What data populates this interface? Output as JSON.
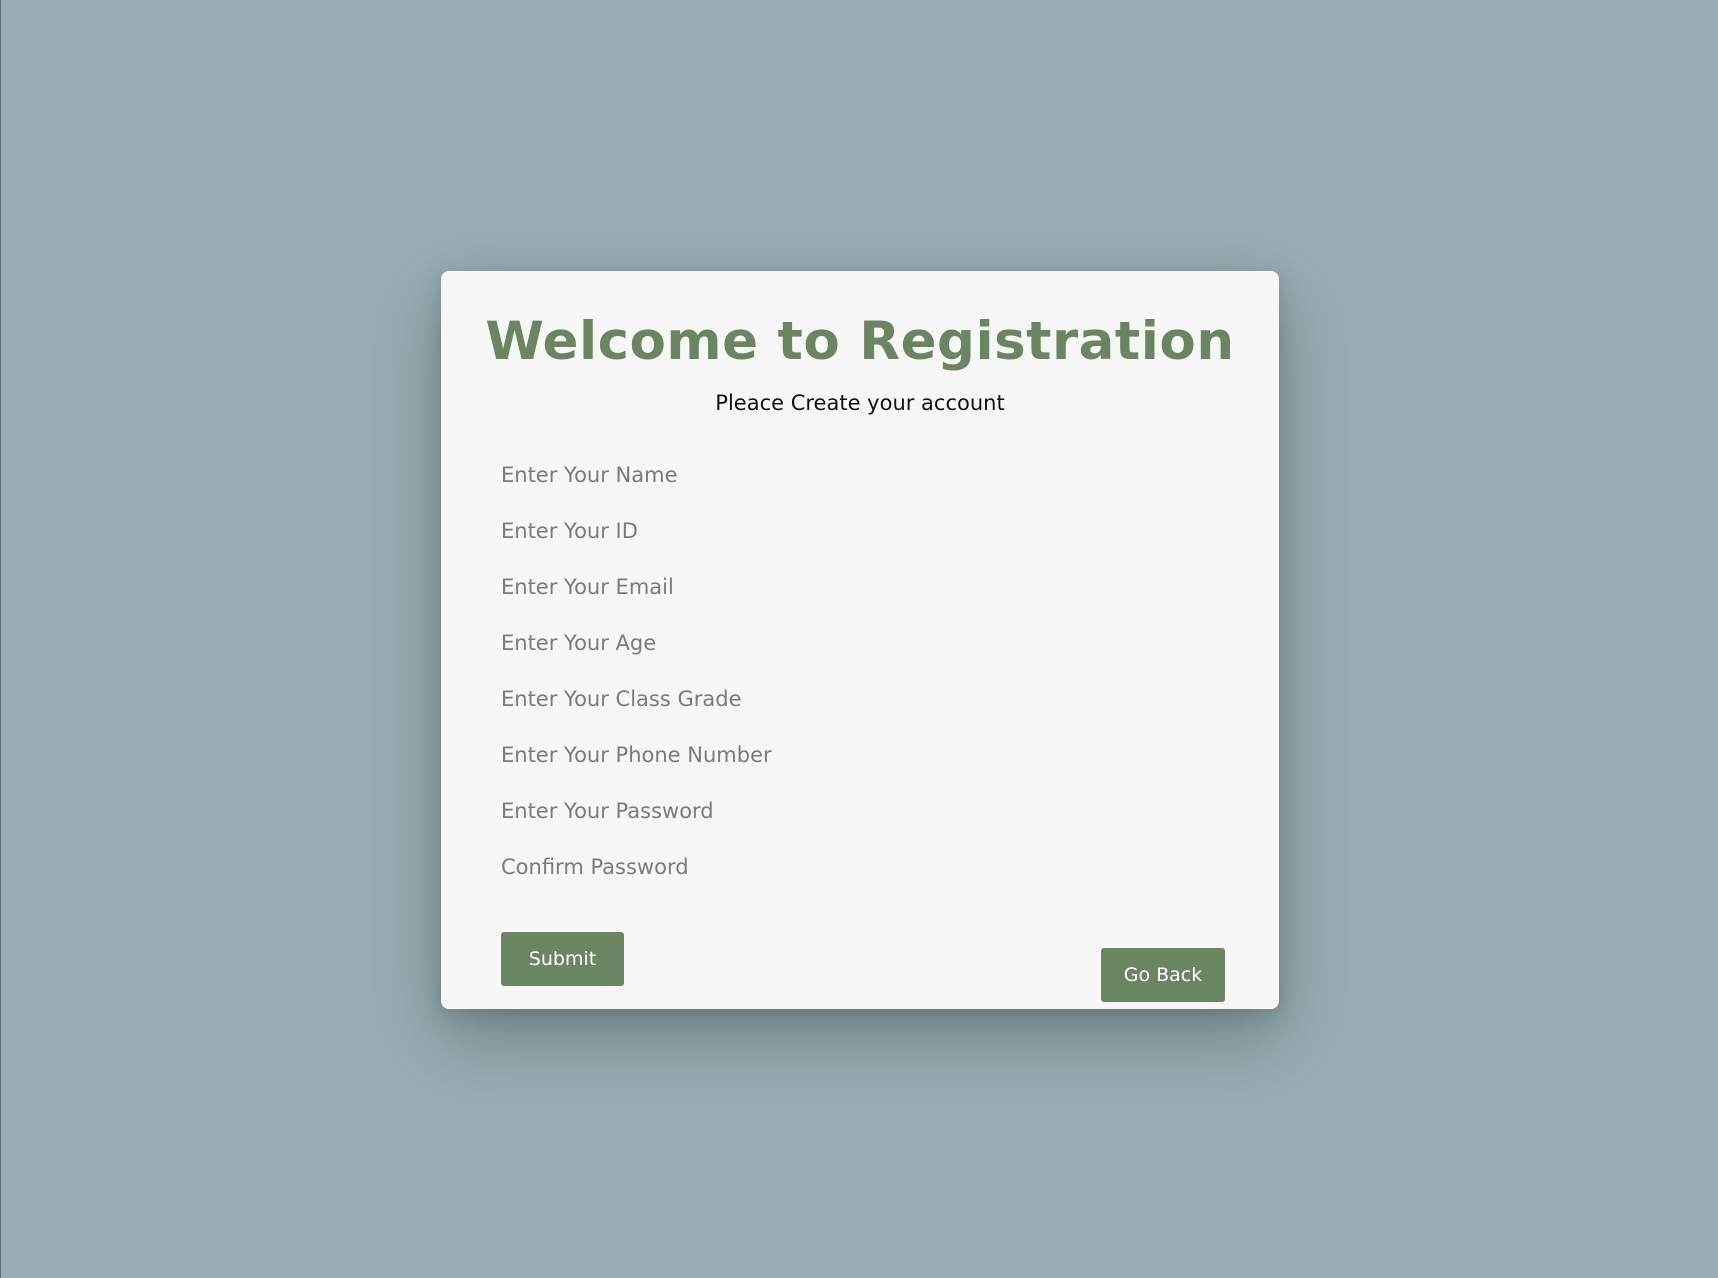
{
  "registration": {
    "title": "Welcome to Registration",
    "subtitle": "Pleace Create your account",
    "fields": [
      {
        "placeholder": "Enter Your Name",
        "value": ""
      },
      {
        "placeholder": "Enter Your ID",
        "value": ""
      },
      {
        "placeholder": "Enter Your Email",
        "value": ""
      },
      {
        "placeholder": "Enter Your Age",
        "value": ""
      },
      {
        "placeholder": "Enter Your Class Grade",
        "value": ""
      },
      {
        "placeholder": "Enter Your Phone Number",
        "value": ""
      },
      {
        "placeholder": "Enter Your Password",
        "value": ""
      },
      {
        "placeholder": "Confirm Password",
        "value": ""
      }
    ],
    "submit_label": "Submit",
    "back_label": "Go Back"
  },
  "colors": {
    "background": "#99adb4",
    "card": "#f7f7f7",
    "accent": "#6b8563",
    "placeholder": "#7b7b7b"
  }
}
